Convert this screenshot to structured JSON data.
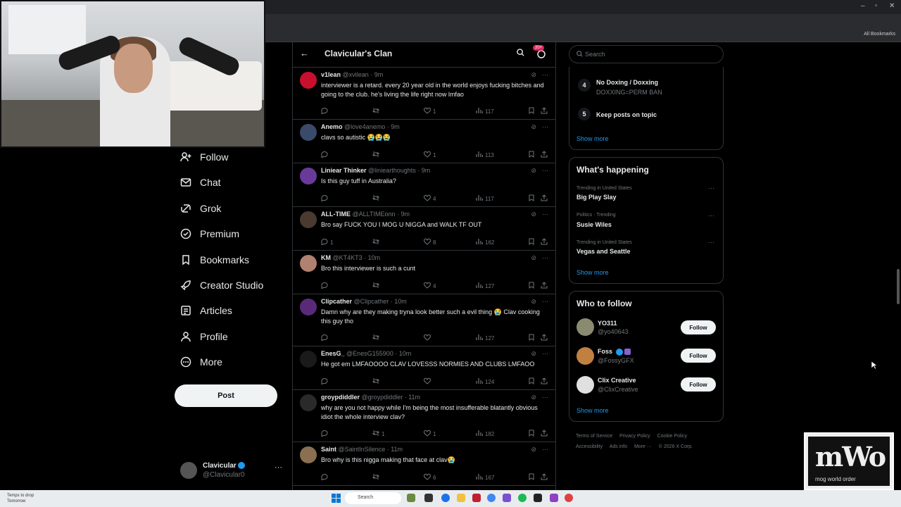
{
  "nav": {
    "items": [
      {
        "label": "Follow",
        "icon": "person-plus-icon"
      },
      {
        "label": "Chat",
        "icon": "mail-icon"
      },
      {
        "label": "Grok",
        "icon": "grok-icon"
      },
      {
        "label": "Premium",
        "icon": "verified-badge-icon"
      },
      {
        "label": "Bookmarks",
        "icon": "bookmark-icon"
      },
      {
        "label": "Creator Studio",
        "icon": "rocket-icon"
      },
      {
        "label": "Articles",
        "icon": "article-icon"
      },
      {
        "label": "Profile",
        "icon": "person-icon"
      },
      {
        "label": "More",
        "icon": "more-circle-icon"
      }
    ],
    "post_label": "Post",
    "account": {
      "name": "Clavicular",
      "handle": "@Clavicular0"
    }
  },
  "community": {
    "title": "Clavicular's Clan",
    "badge": "20+"
  },
  "tweets": [
    {
      "name": "v1lean",
      "handle": "@xvilean",
      "time": "9m",
      "text": "interviewer is a retard. every 20 year old in the world enjoys fucking bitches and going to the club. he's living the life right now lmfao",
      "replies": "",
      "reposts": "",
      "likes": "1",
      "views": "117",
      "avatar_color": "#c8102e"
    },
    {
      "name": "Anemo",
      "handle": "@love4anemo",
      "time": "9m",
      "text": "clavs so autistic 😭😭😭",
      "replies": "",
      "reposts": "",
      "likes": "1",
      "views": "113",
      "avatar_color": "#3a4a6a"
    },
    {
      "name": "Liniear Thinker",
      "handle": "@liniearthoughts",
      "time": "9m",
      "text": "Is this guy tuff in Australia?",
      "replies": "",
      "reposts": "",
      "likes": "4",
      "views": "117",
      "avatar_color": "#6a3a9a"
    },
    {
      "name": "ALL-TIME",
      "handle": "@ALLTIMEonn",
      "time": "9m",
      "text": "Bro say FUCK YOU I MOG U NIGGA and WALK TF OUT",
      "replies": "1",
      "reposts": "",
      "likes": "8",
      "views": "162",
      "avatar_color": "#4a3a30"
    },
    {
      "name": "KM",
      "handle": "@KT4KT3",
      "time": "10m",
      "text": "Bro this interviewer is such a cunt",
      "replies": "",
      "reposts": "",
      "likes": "4",
      "views": "127",
      "avatar_color": "#b08070"
    },
    {
      "name": "Clipcather",
      "handle": "@Clipcather",
      "time": "10m",
      "text": "Damn why are they making tryna look better such a evil thing 😭 Clav cooking this guy tho",
      "replies": "",
      "reposts": "",
      "likes": "",
      "views": "127",
      "avatar_color": "#5a2a7a"
    },
    {
      "name": "EnesG_",
      "handle": "@EnesG155900",
      "time": "10m",
      "text": "He got em LMFAOOOO CLAV LOVESSS NORMIES AND CLUBS LMFAOO",
      "replies": "",
      "reposts": "",
      "likes": "",
      "views": "124",
      "avatar_color": "#1a1a1a"
    },
    {
      "name": "groypdiddler",
      "handle": "@groypdiddler",
      "time": "11m",
      "text": "why are you not happy while I'm being the most insufferable blatantly obvious idiot the whole interview clav?",
      "replies": "",
      "reposts": "1",
      "likes": "1",
      "views": "182",
      "avatar_color": "#2a2a2a"
    },
    {
      "name": "Saint",
      "handle": "@SaintInSilence",
      "time": "11m",
      "text": "Bro why is this nigga making that face at clav😭",
      "replies": "",
      "reposts": "",
      "likes": "6",
      "views": "167",
      "avatar_color": "#8a7050"
    }
  ],
  "search": {
    "placeholder": "Search"
  },
  "rules": [
    {
      "num": "4",
      "title": "No Doxing / Doxxing",
      "sub": "DOXXING=PERM BAN"
    },
    {
      "num": "5",
      "title": "Keep posts on topic",
      "sub": ""
    }
  ],
  "rules_show_more": "Show more",
  "happening": {
    "title": "What's happening",
    "trends": [
      {
        "context": "Trending in United States",
        "name": "Big Play Slay"
      },
      {
        "context": "Politics · Trending",
        "name": "Susie Wiles"
      },
      {
        "context": "Trending in United States",
        "name": "Vegas and Seattle"
      }
    ],
    "show_more": "Show more"
  },
  "who_to_follow": {
    "title": "Who to follow",
    "users": [
      {
        "name": "YO311",
        "handle": "@yo40643",
        "button": "Follow",
        "avatar_color": "#8a8a70"
      },
      {
        "name": "Foss",
        "handle": "@FossyGFX",
        "button": "Follow",
        "avatar_color": "#c08040"
      },
      {
        "name": "Clix Creative",
        "handle": "@ClixCreative",
        "button": "Follow",
        "avatar_color": "#e0e0e0"
      }
    ],
    "show_more": "Show more"
  },
  "footer": [
    "Terms of Service",
    "Privacy Policy",
    "Cookie Policy",
    "Accessibility",
    "Ads info",
    "More ···",
    "© 2026 X Corp."
  ],
  "browser": {
    "bookmarks_label": "All Bookmarks"
  },
  "taskbar": {
    "weather_line1": "Temps to drop",
    "weather_line2": "Tomorrow",
    "search_label": "Search"
  },
  "watermark": {
    "text": "mWo",
    "sub": "mog world order"
  },
  "colors": {
    "accent": "#1d9bf0",
    "bg": "#000000",
    "border": "#2f3336",
    "muted": "#71767b"
  }
}
